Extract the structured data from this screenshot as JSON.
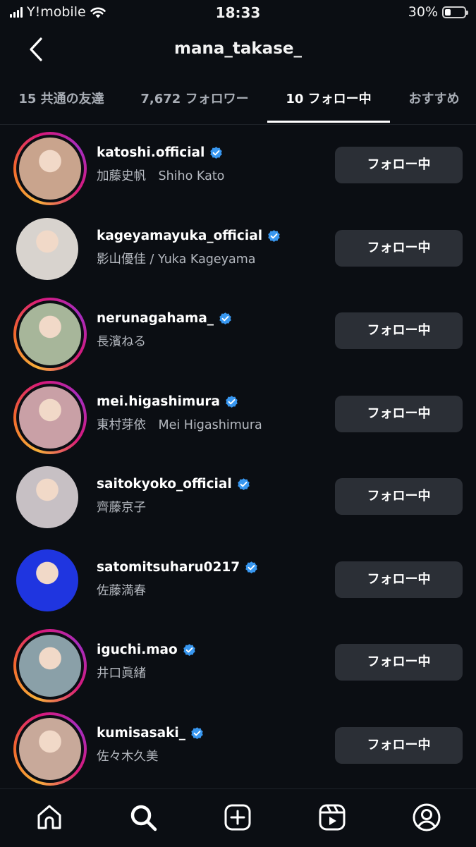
{
  "status_bar": {
    "carrier": "Y!mobile",
    "time": "18:33",
    "battery": "30%",
    "battery_level": 0.3
  },
  "header": {
    "title": "mana_takase_"
  },
  "tabs": [
    {
      "label": "15 共通の友達"
    },
    {
      "label": "7,672 フォロワー"
    },
    {
      "label": "10 フォロー中",
      "active": true
    },
    {
      "label": "おすすめ"
    }
  ],
  "following": [
    {
      "username": "katoshi.official",
      "full_name": "加藤史帆　Shiho Kato",
      "button": "フォロー中",
      "verified": true,
      "story_ring": true,
      "avatar_color": "#c9a48d"
    },
    {
      "username": "kageyamayuka_official",
      "full_name": "影山優佳 / Yuka Kageyama",
      "button": "フォロー中",
      "verified": true,
      "story_ring": false,
      "avatar_color": "#d8d3ce"
    },
    {
      "username": "nerunagahama_",
      "full_name": "長濱ねる",
      "button": "フォロー中",
      "verified": true,
      "story_ring": true,
      "avatar_color": "#a7b69a"
    },
    {
      "username": "mei.higashimura",
      "full_name": "東村芽依　Mei Higashimura",
      "button": "フォロー中",
      "verified": true,
      "story_ring": true,
      "avatar_color": "#c9a0a6"
    },
    {
      "username": "saitokyoko_official",
      "full_name": "齊藤京子",
      "button": "フォロー中",
      "verified": true,
      "story_ring": false,
      "avatar_color": "#c7c0c4"
    },
    {
      "username": "satomitsuharu0217",
      "full_name": "佐藤満春",
      "button": "フォロー中",
      "verified": true,
      "story_ring": false,
      "avatar_color": "#1f35e0"
    },
    {
      "username": "iguchi.mao",
      "full_name": "井口眞緒",
      "button": "フォロー中",
      "verified": true,
      "story_ring": true,
      "avatar_color": "#8aa0a8"
    },
    {
      "username": "kumisasaki_",
      "full_name": "佐々木久美",
      "button": "フォロー中",
      "verified": true,
      "story_ring": true,
      "avatar_color": "#c8a99a"
    }
  ],
  "bottom_nav": [
    {
      "icon": "home-icon"
    },
    {
      "icon": "search-icon",
      "active": true
    },
    {
      "icon": "create-icon"
    },
    {
      "icon": "reels-icon"
    },
    {
      "icon": "profile-icon"
    }
  ],
  "colors": {
    "background": "#0b0e13",
    "button": "#2b2f36",
    "verified": "#3897f0"
  }
}
